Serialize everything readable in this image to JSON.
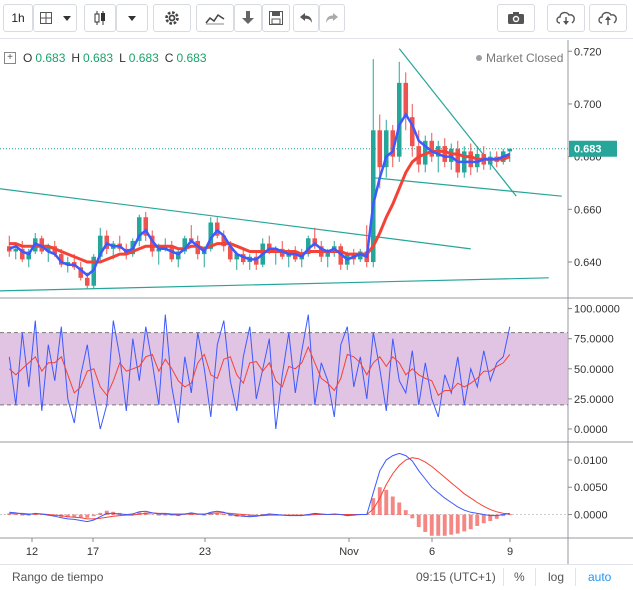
{
  "toolbar": {
    "interval": "1h",
    "icons": [
      "chevron-down-icon",
      "candlestick-icon",
      "chevron-down-icon",
      "gear-icon",
      "indicators-icon",
      "download-icon",
      "save-icon",
      "undo-icon",
      "redo-icon",
      "camera-icon",
      "cloud-download-icon",
      "cloud-upload-icon"
    ]
  },
  "legend": {
    "o_label": "O",
    "o_value": "0.683",
    "h_label": "H",
    "h_value": "0.683",
    "l_label": "L",
    "l_value": "0.683",
    "c_label": "C",
    "c_value": "0.683"
  },
  "market_status": "Market Closed",
  "bottom_bar": {
    "range_label": "Rango de tiempo",
    "time": "09:15 (UTC+1)",
    "percent": "%",
    "log": "log",
    "auto": "auto"
  },
  "colors": {
    "up": "#26a69a",
    "down": "#ef5350",
    "ma_fast": "#3d5afe",
    "ma_slow": "#f44336",
    "trendline": "#26a69a",
    "band": "#d1a3d6",
    "accent": "#2196f3"
  },
  "chart_data": [
    {
      "type": "candlestick",
      "pane": "price",
      "x_tick_labels": [
        "12",
        "17",
        "23",
        "Nov",
        "6",
        "9"
      ],
      "y_ticks": [
        "0.720",
        "0.700",
        "0.680",
        "0.660",
        "0.640"
      ],
      "ylim": [
        0.629,
        0.722
      ],
      "last_price": "0.683",
      "candles_ohlc": [
        [
          0.646,
          0.65,
          0.642,
          0.644
        ],
        [
          0.644,
          0.646,
          0.641,
          0.645
        ],
        [
          0.645,
          0.648,
          0.64,
          0.641
        ],
        [
          0.641,
          0.645,
          0.638,
          0.644
        ],
        [
          0.644,
          0.651,
          0.643,
          0.649
        ],
        [
          0.649,
          0.65,
          0.643,
          0.644
        ],
        [
          0.644,
          0.647,
          0.64,
          0.646
        ],
        [
          0.646,
          0.648,
          0.642,
          0.643
        ],
        [
          0.643,
          0.645,
          0.638,
          0.639
        ],
        [
          0.639,
          0.642,
          0.636,
          0.64
        ],
        [
          0.64,
          0.643,
          0.637,
          0.638
        ],
        [
          0.638,
          0.64,
          0.633,
          0.634
        ],
        [
          0.634,
          0.636,
          0.63,
          0.631
        ],
        [
          0.631,
          0.643,
          0.63,
          0.642
        ],
        [
          0.642,
          0.653,
          0.64,
          0.65
        ],
        [
          0.65,
          0.652,
          0.643,
          0.645
        ],
        [
          0.645,
          0.648,
          0.641,
          0.647
        ],
        [
          0.647,
          0.65,
          0.644,
          0.645
        ],
        [
          0.645,
          0.647,
          0.641,
          0.643
        ],
        [
          0.643,
          0.649,
          0.642,
          0.648
        ],
        [
          0.648,
          0.658,
          0.646,
          0.657
        ],
        [
          0.657,
          0.659,
          0.648,
          0.65
        ],
        [
          0.65,
          0.652,
          0.642,
          0.644
        ],
        [
          0.644,
          0.647,
          0.639,
          0.645
        ],
        [
          0.645,
          0.649,
          0.644,
          0.646
        ],
        [
          0.646,
          0.648,
          0.64,
          0.641
        ],
        [
          0.641,
          0.645,
          0.638,
          0.644
        ],
        [
          0.644,
          0.65,
          0.643,
          0.649
        ],
        [
          0.649,
          0.654,
          0.647,
          0.648
        ],
        [
          0.648,
          0.65,
          0.641,
          0.643
        ],
        [
          0.643,
          0.646,
          0.638,
          0.645
        ],
        [
          0.645,
          0.657,
          0.644,
          0.655
        ],
        [
          0.655,
          0.657,
          0.649,
          0.65
        ],
        [
          0.65,
          0.652,
          0.644,
          0.646
        ],
        [
          0.646,
          0.648,
          0.64,
          0.641
        ],
        [
          0.641,
          0.644,
          0.637,
          0.643
        ],
        [
          0.643,
          0.645,
          0.639,
          0.64
        ],
        [
          0.64,
          0.643,
          0.637,
          0.642
        ],
        [
          0.642,
          0.644,
          0.637,
          0.639
        ],
        [
          0.639,
          0.649,
          0.638,
          0.647
        ],
        [
          0.647,
          0.65,
          0.643,
          0.644
        ],
        [
          0.644,
          0.646,
          0.639,
          0.645
        ],
        [
          0.645,
          0.648,
          0.641,
          0.642
        ],
        [
          0.642,
          0.645,
          0.638,
          0.644
        ],
        [
          0.644,
          0.646,
          0.64,
          0.641
        ],
        [
          0.641,
          0.645,
          0.638,
          0.643
        ],
        [
          0.643,
          0.65,
          0.642,
          0.649
        ],
        [
          0.649,
          0.653,
          0.645,
          0.646
        ],
        [
          0.646,
          0.648,
          0.64,
          0.642
        ],
        [
          0.642,
          0.645,
          0.638,
          0.644
        ],
        [
          0.644,
          0.648,
          0.642,
          0.646
        ],
        [
          0.646,
          0.647,
          0.637,
          0.639
        ],
        [
          0.639,
          0.644,
          0.637,
          0.643
        ],
        [
          0.643,
          0.645,
          0.639,
          0.641
        ],
        [
          0.641,
          0.645,
          0.64,
          0.644
        ],
        [
          0.644,
          0.654,
          0.638,
          0.64
        ],
        [
          0.64,
          0.717,
          0.638,
          0.69
        ],
        [
          0.69,
          0.696,
          0.668,
          0.676
        ],
        [
          0.676,
          0.694,
          0.672,
          0.69
        ],
        [
          0.69,
          0.692,
          0.676,
          0.68
        ],
        [
          0.68,
          0.716,
          0.678,
          0.708
        ],
        [
          0.708,
          0.712,
          0.69,
          0.695
        ],
        [
          0.695,
          0.7,
          0.68,
          0.684
        ],
        [
          0.684,
          0.69,
          0.674,
          0.677
        ],
        [
          0.677,
          0.688,
          0.674,
          0.686
        ],
        [
          0.686,
          0.689,
          0.678,
          0.68
        ],
        [
          0.68,
          0.686,
          0.674,
          0.684
        ],
        [
          0.684,
          0.687,
          0.676,
          0.678
        ],
        [
          0.678,
          0.685,
          0.675,
          0.683
        ],
        [
          0.683,
          0.686,
          0.672,
          0.674
        ],
        [
          0.674,
          0.684,
          0.672,
          0.682
        ],
        [
          0.682,
          0.685,
          0.673,
          0.676
        ],
        [
          0.676,
          0.684,
          0.674,
          0.681
        ],
        [
          0.681,
          0.684,
          0.675,
          0.677
        ],
        [
          0.677,
          0.682,
          0.675,
          0.68
        ],
        [
          0.68,
          0.682,
          0.676,
          0.678
        ],
        [
          0.678,
          0.683,
          0.677,
          0.682
        ],
        [
          0.682,
          0.683,
          0.678,
          0.683
        ]
      ],
      "series": [
        {
          "values": [
            0.645,
            0.646,
            0.644,
            0.643,
            0.647,
            0.646,
            0.644,
            0.643,
            0.64,
            0.639,
            0.639,
            0.637,
            0.635,
            0.637,
            0.643,
            0.647,
            0.646,
            0.646,
            0.644,
            0.645,
            0.65,
            0.652,
            0.648,
            0.645,
            0.645,
            0.644,
            0.643,
            0.645,
            0.648,
            0.646,
            0.644,
            0.649,
            0.652,
            0.65,
            0.646,
            0.643,
            0.642,
            0.641,
            0.641,
            0.643,
            0.645,
            0.645,
            0.644,
            0.643,
            0.643,
            0.642,
            0.645,
            0.647,
            0.645,
            0.644,
            0.645,
            0.643,
            0.641,
            0.642,
            0.643,
            0.642,
            0.662,
            0.672,
            0.68,
            0.682,
            0.692,
            0.696,
            0.692,
            0.686,
            0.684,
            0.682,
            0.681,
            0.68,
            0.68,
            0.678,
            0.678,
            0.678,
            0.678,
            0.679,
            0.679,
            0.679,
            0.68,
            0.681
          ]
        },
        {
          "values": [
            0.647,
            0.647,
            0.646,
            0.646,
            0.646,
            0.646,
            0.646,
            0.645,
            0.644,
            0.643,
            0.642,
            0.641,
            0.64,
            0.64,
            0.64,
            0.641,
            0.642,
            0.643,
            0.643,
            0.644,
            0.645,
            0.646,
            0.646,
            0.646,
            0.646,
            0.646,
            0.645,
            0.645,
            0.646,
            0.646,
            0.645,
            0.646,
            0.647,
            0.647,
            0.647,
            0.646,
            0.645,
            0.644,
            0.644,
            0.644,
            0.644,
            0.644,
            0.644,
            0.644,
            0.644,
            0.643,
            0.644,
            0.644,
            0.644,
            0.644,
            0.644,
            0.644,
            0.643,
            0.643,
            0.643,
            0.643,
            0.646,
            0.651,
            0.657,
            0.662,
            0.668,
            0.674,
            0.678,
            0.68,
            0.681,
            0.682,
            0.682,
            0.682,
            0.681,
            0.681,
            0.68,
            0.68,
            0.679,
            0.679,
            0.679,
            0.679,
            0.679,
            0.68
          ]
        }
      ]
    },
    {
      "type": "line",
      "pane": "oscillator",
      "y_ticks": [
        "100.0000",
        "75.0000",
        "50.0000",
        "25.0000",
        "0.0000"
      ],
      "ylim": [
        -5,
        103
      ],
      "band": [
        20,
        80
      ],
      "series": [
        {
          "values": [
            60,
            20,
            80,
            35,
            90,
            15,
            70,
            40,
            85,
            25,
            5,
            45,
            70,
            30,
            0,
            20,
            90,
            60,
            15,
            75,
            40,
            85,
            55,
            20,
            95,
            35,
            5,
            60,
            30,
            80,
            50,
            10,
            70,
            90,
            40,
            15,
            60,
            85,
            25,
            50,
            75,
            0,
            45,
            80,
            30,
            65,
            95,
            20,
            55,
            40,
            10,
            70,
            85,
            35,
            60,
            25,
            80,
            50,
            15,
            75,
            40,
            30,
            65,
            20,
            55,
            25,
            10,
            45,
            30,
            60,
            20,
            50,
            35,
            65,
            40,
            55,
            60,
            85
          ]
        },
        {
          "values": [
            50,
            45,
            50,
            55,
            60,
            48,
            55,
            55,
            60,
            45,
            30,
            35,
            48,
            50,
            35,
            28,
            40,
            55,
            48,
            50,
            52,
            60,
            62,
            48,
            58,
            50,
            40,
            35,
            38,
            55,
            62,
            45,
            42,
            58,
            60,
            45,
            38,
            55,
            56,
            48,
            55,
            40,
            35,
            52,
            50,
            55,
            68,
            55,
            42,
            38,
            32,
            42,
            62,
            60,
            55,
            45,
            55,
            60,
            52,
            60,
            55,
            45,
            50,
            45,
            42,
            40,
            28,
            32,
            32,
            38,
            35,
            38,
            42,
            48,
            48,
            52,
            55,
            62
          ]
        }
      ]
    },
    {
      "type": "line",
      "pane": "macd",
      "y_ticks": [
        "0.0100",
        "0.0050",
        "0.0000"
      ],
      "ylim": [
        -0.0032,
        0.012
      ],
      "series": [
        {
          "values": [
            0.0004,
            0.0003,
            0.0001,
            0.0,
            0.0002,
            0.0001,
            -0.0001,
            -0.0003,
            -0.0006,
            -0.0008,
            -0.0009,
            -0.0011,
            -0.0013,
            -0.001,
            -0.0004,
            0.0002,
            0.0002,
            0.0001,
            0.0,
            0.0001,
            0.0005,
            0.0006,
            0.0003,
            0.0001,
            0.0001,
            0.0,
            -0.0001,
            0.0001,
            0.0003,
            0.0001,
            0.0,
            0.0004,
            0.0006,
            0.0004,
            0.0,
            -0.0002,
            -0.0003,
            -0.0004,
            -0.0003,
            -0.0001,
            0.0001,
            0.0,
            -0.0001,
            -0.0002,
            -0.0002,
            -0.0002,
            0.0,
            0.0002,
            0.0001,
            0.0,
            0.0001,
            0.0,
            -0.0002,
            -0.0001,
            0.0,
            0.0,
            0.004,
            0.008,
            0.01,
            0.0108,
            0.0112,
            0.0108,
            0.0098,
            0.008,
            0.0065,
            0.005,
            0.004,
            0.003,
            0.0022,
            0.0014,
            0.0008,
            0.0004,
            0.0002,
            0.0,
            -0.0002,
            -0.0002,
            0.0,
            0.0002
          ]
        },
        {
          "values": [
            0.0002,
            0.0002,
            0.0002,
            0.0001,
            0.0001,
            0.0001,
            0.0,
            -0.0001,
            -0.0002,
            -0.0004,
            -0.0005,
            -0.0006,
            -0.0008,
            -0.0008,
            -0.0007,
            -0.0005,
            -0.0003,
            -0.0002,
            -0.0001,
            -0.0001,
            0.0001,
            0.0002,
            0.0003,
            0.0002,
            0.0002,
            0.0001,
            0.0001,
            0.0001,
            0.0001,
            0.0001,
            0.0001,
            0.0002,
            0.0003,
            0.0003,
            0.0002,
            0.0001,
            0.0,
            -0.0001,
            -0.0002,
            -0.0002,
            -0.0001,
            -0.0001,
            -0.0001,
            -0.0001,
            -0.0001,
            -0.0001,
            -0.0001,
            0.0,
            0.0,
            0.0,
            0.0,
            0.0,
            0.0,
            0.0,
            0.0,
            0.0,
            0.001,
            0.003,
            0.0055,
            0.0075,
            0.009,
            0.01,
            0.0104,
            0.0102,
            0.0096,
            0.0088,
            0.0078,
            0.0068,
            0.0058,
            0.0048,
            0.0038,
            0.003,
            0.0022,
            0.0015,
            0.0009,
            0.0005,
            0.0002,
            0.0001
          ]
        }
      ]
    }
  ]
}
